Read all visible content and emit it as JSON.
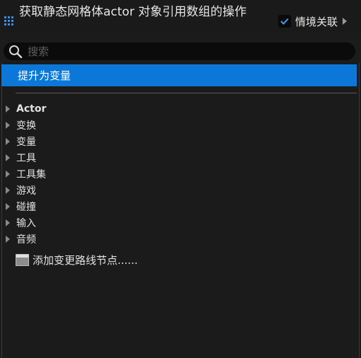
{
  "header": {
    "title": "获取静态网格体actor 对象引用数组的操作",
    "context_sensitive": {
      "label": "情境关联",
      "checked": true
    }
  },
  "search": {
    "placeholder": "搜索",
    "value": ""
  },
  "actions": {
    "promote_label": "提升为变量",
    "categories": [
      {
        "label": "Actor"
      },
      {
        "label": "变换"
      },
      {
        "label": "变量"
      },
      {
        "label": "工具"
      },
      {
        "label": "工具集"
      },
      {
        "label": "游戏"
      },
      {
        "label": "碰撞"
      },
      {
        "label": "输入"
      },
      {
        "label": "音频"
      }
    ],
    "reroute_label": "添加变更路线节点......"
  },
  "colors": {
    "accent": "#0b78d9",
    "grid_icon": "#3a8ee6",
    "background": "#1b1b1b"
  },
  "icons": {
    "menu": "grid-icon",
    "search": "search-icon",
    "check": "check-icon",
    "expand": "triangle-right-icon",
    "node": "reroute-node-icon"
  }
}
